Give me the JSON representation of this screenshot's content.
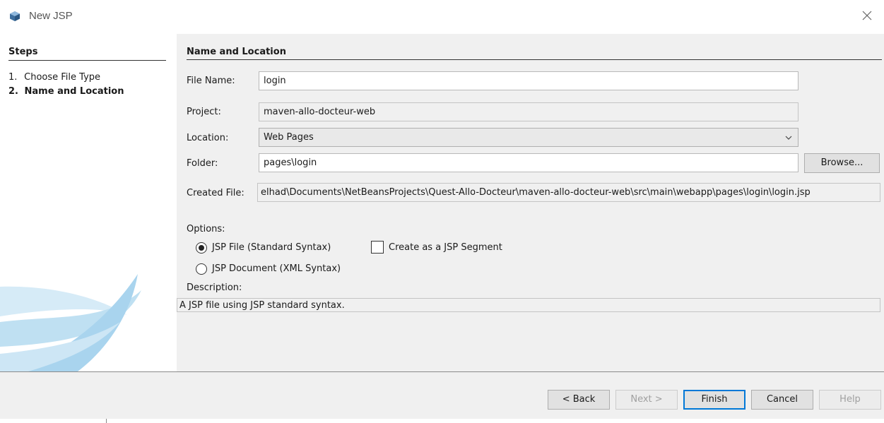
{
  "window": {
    "title": "New JSP",
    "icon": "netbeans-cube-icon",
    "close_icon": "close-icon"
  },
  "steps": {
    "title": "Steps",
    "items": [
      {
        "num": "1.",
        "label": "Choose File Type",
        "current": false
      },
      {
        "num": "2.",
        "label": "Name and Location",
        "current": true
      }
    ]
  },
  "section": {
    "title": "Name and Location"
  },
  "form": {
    "file_name_label": "File Name:",
    "file_name_value": "login",
    "project_label": "Project:",
    "project_value": "maven-allo-docteur-web",
    "location_label": "Location:",
    "location_value": "Web Pages",
    "folder_label": "Folder:",
    "folder_value": "pages\\login",
    "browse_label": "Browse...",
    "created_file_label": "Created File:",
    "created_file_value": "elhad\\Documents\\NetBeansProjects\\Quest-Allo-Docteur\\maven-allo-docteur-web\\src\\main\\webapp\\pages\\login\\login.jsp"
  },
  "options": {
    "label": "Options:",
    "radio_jsp_file": "JSP File (Standard Syntax)",
    "radio_jsp_file_selected": true,
    "checkbox_segment": "Create as a JSP Segment",
    "checkbox_segment_checked": false,
    "radio_jsp_document": "JSP Document (XML Syntax)",
    "radio_jsp_document_selected": false
  },
  "description": {
    "label": "Description:",
    "text": "A JSP file using JSP standard syntax."
  },
  "buttons": {
    "back": "< Back",
    "next": "Next >",
    "finish": "Finish",
    "cancel": "Cancel",
    "help": "Help"
  },
  "colors": {
    "panel_bg": "#f0f0f0",
    "default_button_border": "#0078d7",
    "swoosh": "#b9dbef"
  }
}
